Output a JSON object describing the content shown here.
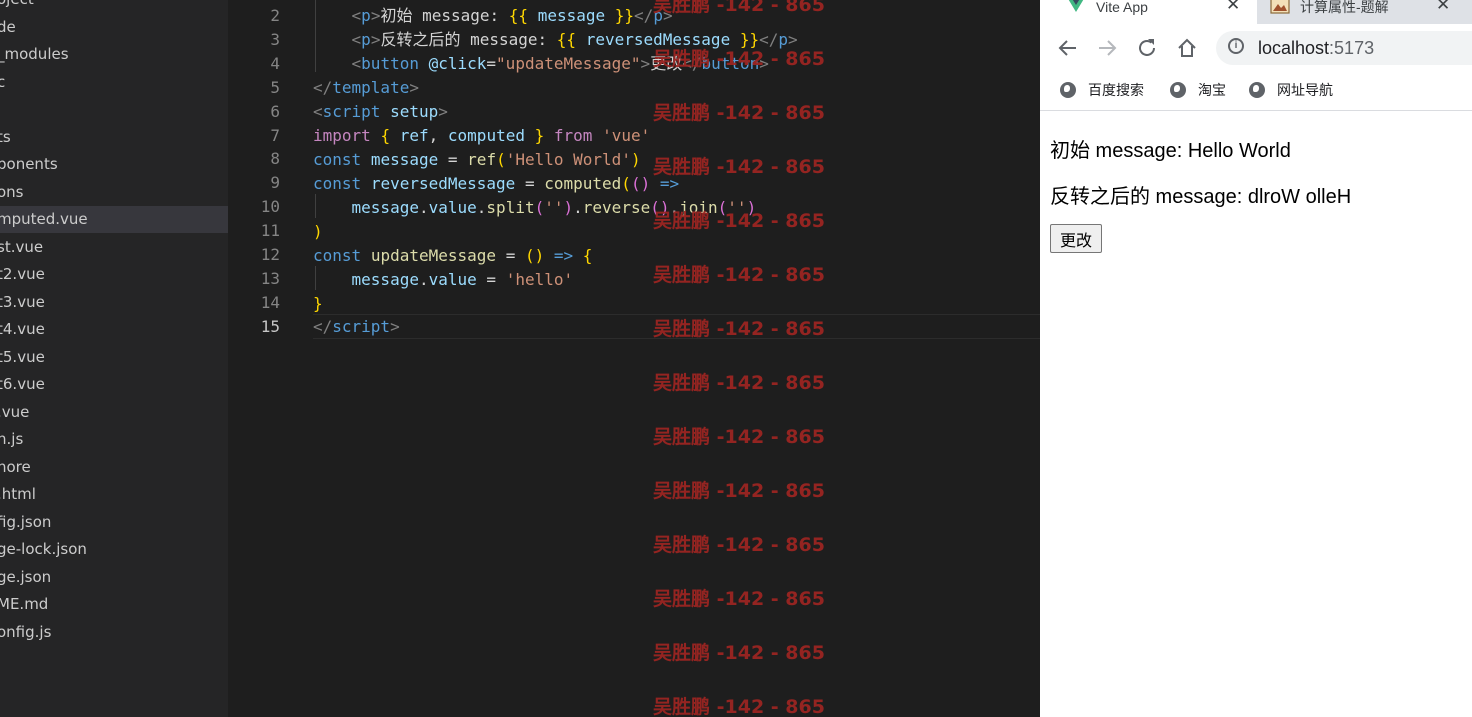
{
  "explorer": {
    "items": [
      "oject",
      "de",
      "_modules",
      "c",
      "",
      "ts",
      "ponents",
      "ons",
      "mputed.vue",
      "st.vue",
      "t2.vue",
      "t3.vue",
      "t4.vue",
      "t5.vue",
      "t6.vue",
      ".vue",
      "n.js",
      "nore",
      ".html",
      "fig.json",
      "ge-lock.json",
      "ge.json",
      "ME.md",
      "onfig.js"
    ],
    "active_index": 8
  },
  "editor": {
    "line_numbers": [
      "2",
      "3",
      "4",
      "5",
      "6",
      "7",
      "8",
      "9",
      "10",
      "11",
      "12",
      "13",
      "14",
      "15"
    ],
    "current_line": "15"
  },
  "watermark": {
    "text": "吴胜鹏 -142 - 865"
  },
  "browser": {
    "tabs": [
      {
        "title": "Vite App",
        "icon": "vite-icon"
      },
      {
        "title": "计算属性-题解",
        "icon": "tab-image-icon"
      }
    ],
    "close_glyph": "✕",
    "url": {
      "host": "localhost",
      "port": ":5173"
    },
    "bookmarks": [
      "百度搜索",
      "淘宝",
      "网址导航"
    ],
    "page": {
      "line1": "初始 message: Hello World",
      "line2": "反转之后的 message: dlroW olleH",
      "button": "更改"
    }
  },
  "colors": {
    "watermark": "#9b2522",
    "editor_bg": "#1e1e1e",
    "sidebar_bg": "#252526"
  }
}
